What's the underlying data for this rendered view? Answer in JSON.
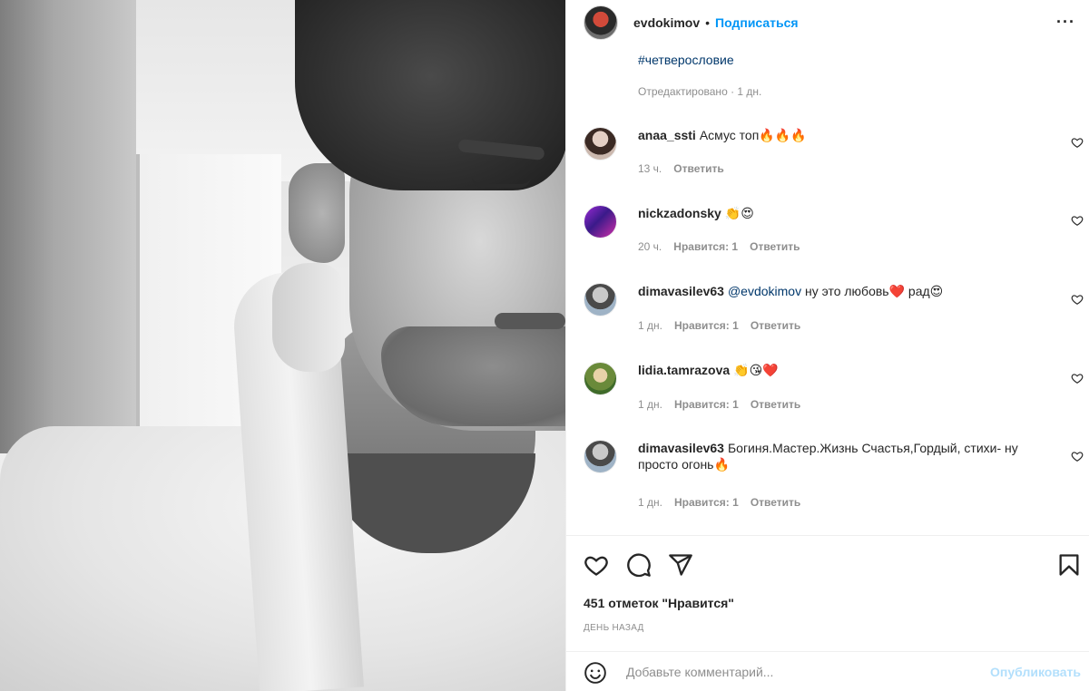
{
  "header": {
    "username": "evdokimov",
    "separator": "•",
    "follow_label": "Подписаться",
    "more_icon": "more-horizontal-icon",
    "more_label": "···"
  },
  "caption": {
    "hashtag": "#четверословие",
    "edited": "Отредактировано · 1 дн."
  },
  "comments": [
    {
      "user": "anaa_ssti",
      "mention": "",
      "text": "Асмус топ",
      "emoji": "🔥🔥🔥",
      "time": "13 ч.",
      "likes": "",
      "reply_label": "Ответить"
    },
    {
      "user": "nickzadonsky",
      "mention": "",
      "text": "",
      "emoji": "👏😍",
      "time": "20 ч.",
      "likes": "Нравится: 1",
      "reply_label": "Ответить"
    },
    {
      "user": "dimavasilev63",
      "mention": "@evdokimov",
      "text": " ну это любовь",
      "emoji": "❤️ рад😍",
      "time": "1 дн.",
      "likes": "Нравится: 1",
      "reply_label": "Ответить"
    },
    {
      "user": "lidia.tamrazova",
      "mention": "",
      "text": "",
      "emoji": "👏😘❤️",
      "time": "1 дн.",
      "likes": "Нравится: 1",
      "reply_label": "Ответить"
    },
    {
      "user": "dimavasilev63",
      "mention": "",
      "text": "Богиня.Мастер.Жизнь Счастья,Гордый, стихи- ну просто огонь",
      "emoji": "🔥",
      "time": "1 дн.",
      "likes": "Нравится: 1",
      "reply_label": "Ответить"
    }
  ],
  "actions": {
    "like_icon": "heart-icon",
    "comment_icon": "comment-icon",
    "share_icon": "send-icon",
    "save_icon": "bookmark-icon",
    "likes_count": "451 отметок \"Нравится\"",
    "date": "ДЕНЬ НАЗАД"
  },
  "add_comment": {
    "emoji_icon": "smiley-icon",
    "placeholder": "Добавьте комментарий...",
    "post_label": "Опубликовать"
  },
  "colors": {
    "accent": "#0095f6",
    "link": "#00376b",
    "muted": "#8e8e8e",
    "post_disabled": "#b2dffc"
  }
}
